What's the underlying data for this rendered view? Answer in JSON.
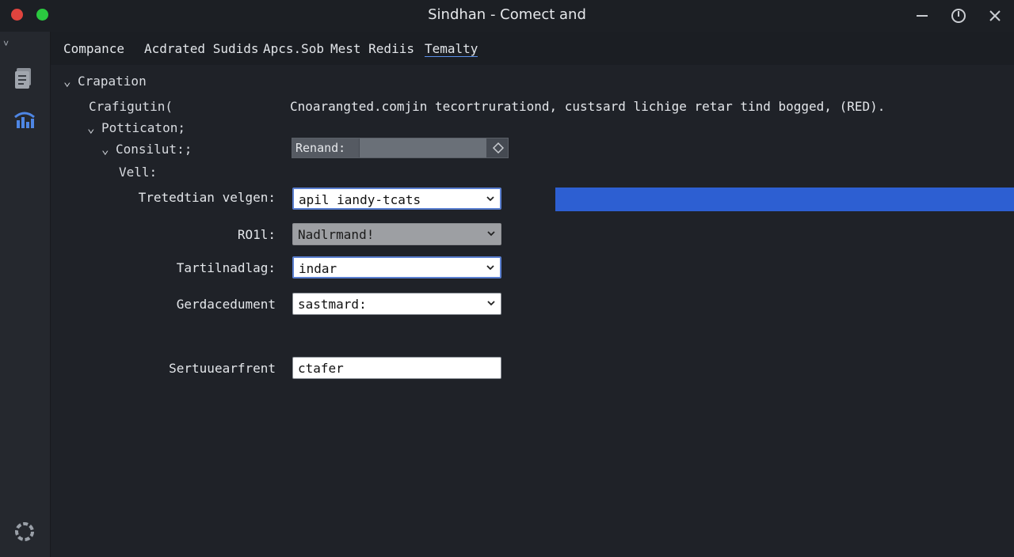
{
  "window": {
    "title": "Sindhan - Comect and",
    "controls": [
      "minimize-icon",
      "power-icon",
      "close-icon"
    ]
  },
  "sidebar": {
    "icons": [
      "document-icon",
      "chart-icon",
      "settings-icon"
    ]
  },
  "menu": {
    "items": [
      "Compance",
      "Acdrated Sudids",
      "Apcs.Sob",
      "Mest Rediis",
      "Temalty"
    ]
  },
  "tree": {
    "root": "Crapation",
    "child1": "Crafigutin(",
    "child2": "Potticaton;",
    "child3": "Consilut:;",
    "child4": "Vell:"
  },
  "description": "Cnoarangted.comjin tecortrurationd, custsard lichige retar tind bogged, (RED).",
  "rename": {
    "label": "Renand:",
    "value": ""
  },
  "form": {
    "field1": {
      "label": "Tretedtian velgen:",
      "value": "apil iandy-tcats"
    },
    "field2": {
      "label": "RO1l:",
      "value": "Nadlrmand!"
    },
    "field3": {
      "label": "Tartilnadlag:",
      "value": "indar"
    },
    "field4": {
      "label": "Gerdacedument",
      "value": "sastmard:"
    },
    "field5": {
      "label": "Sertuuearfrent",
      "value": "ctafer"
    }
  },
  "progress": {
    "fraction": 1.0
  },
  "colors": {
    "accent": "#2d5fd2",
    "background": "#1f2228",
    "titlebar": "#1c1f24",
    "sidebar": "#25282e",
    "close_dot": "#e0443e",
    "max_dot": "#2bc840"
  }
}
